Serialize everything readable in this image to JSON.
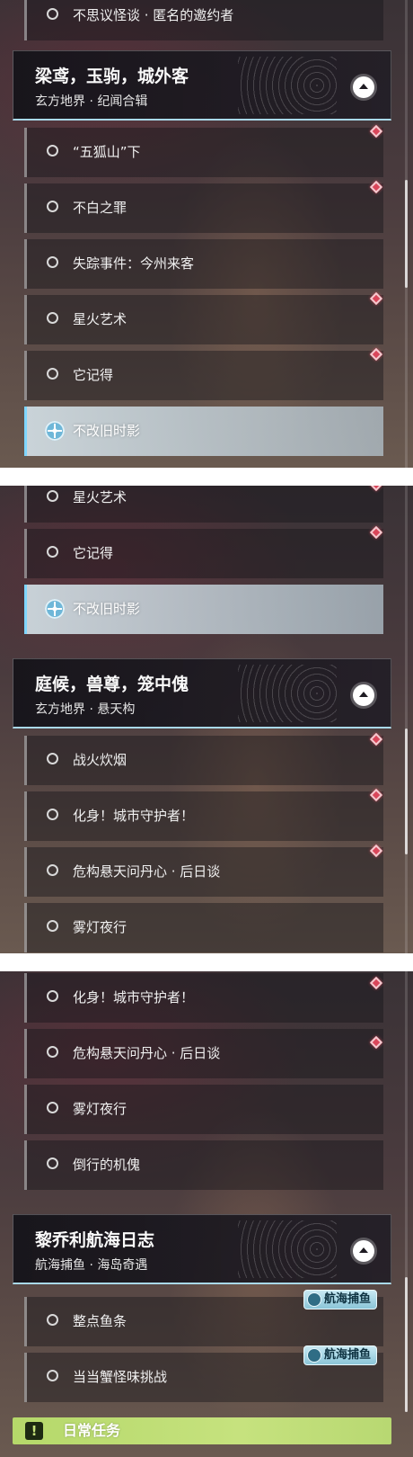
{
  "panels": [
    {
      "items_before": [
        {
          "label": "不思议怪谈 · 匿名的邀约者",
          "active": false
        }
      ],
      "header": {
        "title": "梁鸢，玉驹，城外客",
        "subtitle": "玄方地界 · 纪闻合辑"
      },
      "items_after": [
        {
          "label": "“五狐山”下",
          "active": false
        },
        {
          "label": "不白之罪",
          "active": false
        },
        {
          "label": "失踪事件：今州来客",
          "active": false
        },
        {
          "label": "星火艺术",
          "active": false
        },
        {
          "label": "它记得",
          "active": false
        },
        {
          "label": "不改旧时影",
          "active": true
        }
      ]
    },
    {
      "items_before": [
        {
          "label": "星火艺术",
          "active": false
        },
        {
          "label": "它记得",
          "active": false
        },
        {
          "label": "不改旧时影",
          "active": true
        }
      ],
      "header": {
        "title": "庭候，兽尊，笼中傀",
        "subtitle": "玄方地界 · 悬天构"
      },
      "items_after": [
        {
          "label": "战火炊烟",
          "active": false
        },
        {
          "label": "化身！城市守护者！",
          "active": false
        },
        {
          "label": "危构悬天问丹心 · 后日谈",
          "active": false
        },
        {
          "label": "雾灯夜行",
          "active": false
        }
      ]
    },
    {
      "items_before": [
        {
          "label": "化身！城市守护者！",
          "active": false
        },
        {
          "label": "危构悬天问丹心 · 后日谈",
          "active": false
        },
        {
          "label": "雾灯夜行",
          "active": false
        },
        {
          "label": "倒行的机傀",
          "active": false
        }
      ],
      "header": {
        "title": "黎乔利航海日志",
        "subtitle": "航海捕鱼 · 海岛奇遇"
      },
      "items_after": [
        {
          "label": "整点鱼条",
          "active": false,
          "badge": "航海捕鱼"
        },
        {
          "label": "当当蟹怪味挑战",
          "active": false,
          "badge": "航海捕鱼"
        }
      ]
    }
  ],
  "daily": {
    "icon": "!",
    "label": "日常任务"
  },
  "icons": {
    "quest_status": "circle-outline-icon",
    "tracked": "crosshair-target-icon",
    "new_marker": "red-diamond-icon",
    "collapse": "chevron-up-icon",
    "badge": "fish-hook-icon",
    "daily": "exclamation-icon"
  },
  "colors": {
    "new_marker": "#d9465a",
    "tracked_accent": "#7fd6ff",
    "daily_bar": "#b5d86a"
  }
}
